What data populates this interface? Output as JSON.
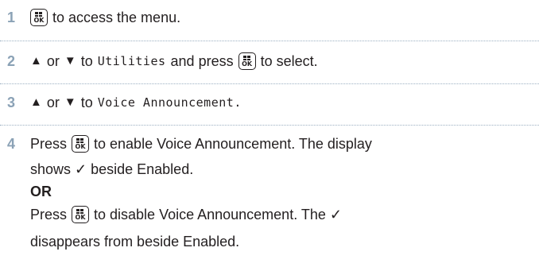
{
  "steps": [
    {
      "number": "1",
      "text_after_key": "to access the menu."
    },
    {
      "number": "2",
      "text_or": "or",
      "text_to": "to",
      "menu_item": "Utilities",
      "text_and_press": "and press",
      "text_select": "to select."
    },
    {
      "number": "3",
      "text_or": "or",
      "text_to": "to",
      "menu_item": "Voice Announcement",
      "period": "."
    },
    {
      "number": "4",
      "line1_press": "Press",
      "line1_rest": "to enable Voice Announcement. The display",
      "line2": "shows ✓ beside Enabled.",
      "or_label": "OR",
      "line4_press": "Press",
      "line4_rest": "to disable Voice Announcement. The ✓",
      "line5": "disappears from beside Enabled."
    }
  ],
  "icons": {
    "menu_ok_key": "menu-ok-key-icon",
    "up": "▲",
    "down": "▼"
  },
  "colors": {
    "step_number": "#8ba2b6",
    "divider": "#9cb0c2",
    "text": "#231f20"
  }
}
